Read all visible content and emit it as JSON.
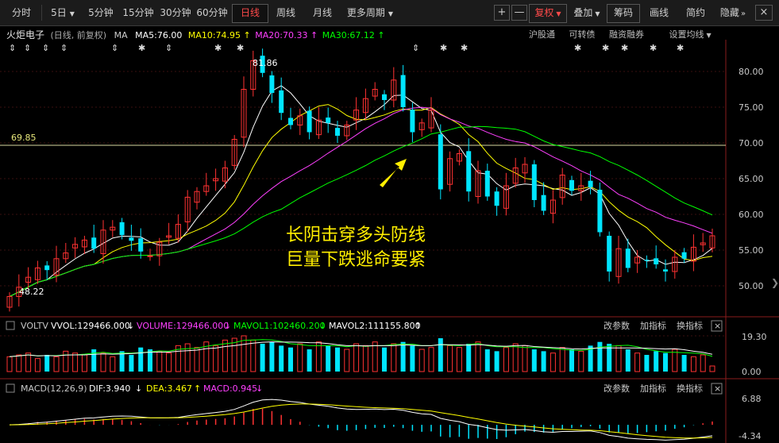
{
  "toolbar": {
    "items": [
      "分时",
      "5日",
      "5分钟",
      "15分钟",
      "30分钟",
      "60分钟",
      "日线",
      "周线",
      "月线",
      "更多周期"
    ],
    "active": "日线",
    "plus": "+",
    "minus": "—",
    "fuquan": "复权",
    "overlay": "叠加",
    "chips": "筹码",
    "draw": "画线",
    "simple": "简约",
    "hide": "隐藏",
    "close": "×"
  },
  "header": {
    "stock_name": "火炬电子",
    "mode": "(日线, 前复权)",
    "ma_label": "MA",
    "ma5": "MA5:76.00",
    "ma10": "MA10:74.95",
    "ma20": "MA20:70.33",
    "ma30": "MA30:67.12",
    "links": [
      "沪股通",
      "可转债",
      "融资融券",
      "设置均线"
    ]
  },
  "price_axis": [
    "80.00",
    "75.00",
    "70.00",
    "65.00",
    "60.00",
    "55.00",
    "50.00"
  ],
  "price_annotations": {
    "high": "81.86",
    "low": "48.22",
    "line_value": "69.85"
  },
  "annotation": {
    "line1": "长阴击穿多头防线",
    "line2": "巨量下跌逃命要紧"
  },
  "volume_panel": {
    "title": "VOLTV",
    "vvol": "VVOL:129466.000",
    "volume": "VOLUME:129466.000",
    "mavol1": "MAVOL1:102460.200",
    "mavol2": "MAVOL2:111155.800",
    "buttons": [
      "改参数",
      "加指标",
      "换指标"
    ],
    "axis": [
      "19.30",
      "0.00"
    ]
  },
  "macd_panel": {
    "title": "MACD(12,26,9)",
    "dif": "DIF:3.940",
    "dea": "DEA:3.467",
    "macd": "MACD:0.945",
    "buttons": [
      "改参数",
      "加指标",
      "换指标"
    ],
    "axis": [
      "6.88",
      "-4.34"
    ]
  },
  "colors": {
    "up": "#ff3232",
    "down": "#00e5ff",
    "ma5": "#ffffff",
    "ma10": "#ffff00",
    "ma20": "#ff40ff",
    "ma30": "#00ff00",
    "annotation": "#ffff00",
    "background": "#000000"
  },
  "chart_data": {
    "type": "candlestick",
    "closes": [
      48.5,
      49.8,
      51.2,
      52.5,
      52.2,
      53.8,
      54.6,
      55.8,
      56.4,
      55.2,
      57.8,
      58.2,
      57.1,
      56.3,
      54.8,
      54.2,
      56.1,
      57.0,
      58.6,
      62.4,
      63.2,
      64.0,
      65.0,
      66.5,
      70.5,
      77.5,
      81.5,
      79.8,
      77.0,
      74.2,
      72.5,
      73.8,
      71.5,
      73.2,
      72.8,
      71.0,
      72.5,
      74.6,
      76.2,
      77.5,
      76.0,
      78.8,
      75.0,
      71.5,
      72.8,
      74.6,
      63.5,
      67.8,
      68.5,
      63.2,
      66.1,
      62.5,
      61.2,
      64.0,
      66.5,
      67.0,
      62.0,
      60.5,
      62.0,
      65.5,
      63.3,
      64.0,
      63.8,
      57.5,
      52.0,
      55.2,
      52.5,
      54.0,
      53.5,
      53.0,
      52.0,
      54.0,
      53.8,
      55.4,
      56.0,
      57.0
    ],
    "volumes": [
      8,
      9,
      10,
      7,
      9,
      8,
      11,
      10,
      9,
      12,
      10,
      8,
      11,
      9,
      13,
      12,
      11,
      10,
      14,
      15,
      13,
      16,
      14,
      17,
      18,
      19.3,
      17,
      15,
      16,
      14,
      13,
      15,
      12,
      16,
      14,
      13,
      12,
      15,
      14,
      16,
      13,
      15,
      16,
      14,
      12,
      13,
      18,
      14,
      13,
      15,
      16,
      12,
      11,
      13,
      15,
      14,
      12,
      11,
      10,
      13,
      12,
      11,
      14,
      16,
      15,
      14,
      12,
      10,
      9,
      11,
      10,
      12,
      9,
      8,
      9,
      3
    ],
    "price_range": [
      46.5,
      84.0
    ],
    "volume_range": [
      0,
      19.3
    ],
    "macd_range": [
      -4.34,
      6.88
    ]
  }
}
